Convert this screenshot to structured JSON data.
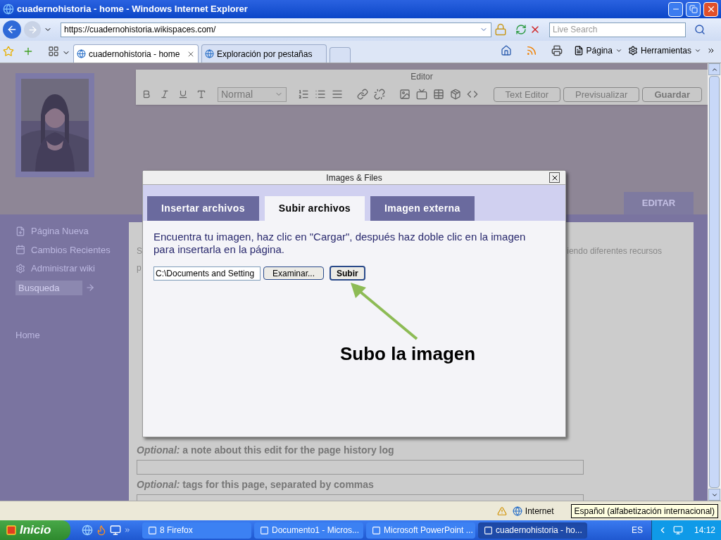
{
  "window": {
    "title": "cuadernohistoria - home - Windows Internet Explorer"
  },
  "address_bar": {
    "url": "https://cuadernohistoria.wikispaces.com/",
    "search_placeholder": "Live Search"
  },
  "tabs": [
    {
      "label": "cuadernohistoria - home",
      "selected": true
    },
    {
      "label": "Exploración por pestañas",
      "selected": false
    }
  ],
  "commands": [
    "Página",
    "Herramientas"
  ],
  "editor": {
    "title": "Editor",
    "style_select": "Normal",
    "buttons": [
      "Text Editor",
      "Previsualizar",
      "Guardar"
    ]
  },
  "page": {
    "sidebar": [
      {
        "label": "Página Nueva",
        "kind": "new-page"
      },
      {
        "label": "Cambios Recientes",
        "kind": "calendar"
      },
      {
        "label": "Administrar wiki",
        "kind": "gear"
      }
    ],
    "search_placeholder": "Busqueda",
    "home_link": "Home",
    "edit_tab": "EDITAR",
    "body_fragments": [
      "S",
      "p",
      "iendo diferentes recursos"
    ],
    "fields": [
      {
        "label": "*Optional:* a note about this edit for the page history log"
      },
      {
        "label": "*Optional:* tags for this page, separated by commas"
      }
    ]
  },
  "dialog": {
    "title": "Images & Files",
    "tabs": [
      {
        "label": "Insertar archivos",
        "selected": false
      },
      {
        "label": "Subir archivos",
        "selected": true
      },
      {
        "label": "Imagen externa",
        "selected": false
      }
    ],
    "instructions": "Encuentra tu imagen, haz clic en \"Cargar\", después haz doble clic en la imagen para insertarla en la página.",
    "file_value": "C:\\Documents and Setting",
    "browse_button": "Examinar...",
    "upload_button": "Subir"
  },
  "annotation": "Subo la imagen",
  "status_bar": {
    "zone": "Internet",
    "tooltip": "Español (alfabetización internacional)"
  },
  "taskbar": {
    "start": "Inicio",
    "buttons": [
      {
        "label": "8 Firefox",
        "selected": false
      },
      {
        "label": "Documento1 - Micros...",
        "selected": false
      },
      {
        "label": "Microsoft PowerPoint ...",
        "selected": false
      },
      {
        "label": "cuadernohistoria - ho...",
        "selected": true
      }
    ],
    "language": "ES",
    "clock": "14:12"
  }
}
